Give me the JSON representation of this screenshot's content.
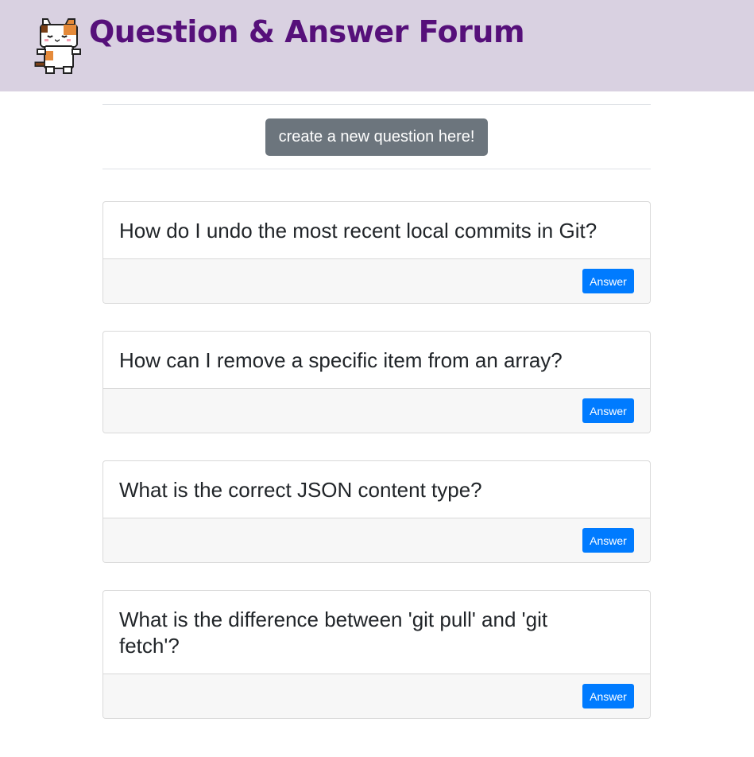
{
  "header": {
    "title": "Question & Answer Forum",
    "logo_icon": "pixel-cat-icon"
  },
  "toolbar": {
    "create_label": "create a new question here!"
  },
  "colors": {
    "header_bg": "#d9d1e1",
    "title": "#56107a",
    "create_button": "#6c757d",
    "answer_button": "#007bff"
  },
  "questions": [
    {
      "text": "How do I undo the most recent local commits in Git?",
      "action_label": "Answer"
    },
    {
      "text": "How can I remove a specific item from an array?",
      "action_label": "Answer"
    },
    {
      "text": "What is the correct JSON content type?",
      "action_label": "Answer"
    },
    {
      "text": "What is the difference between 'git pull' and 'git fetch'?",
      "action_label": "Answer"
    }
  ]
}
